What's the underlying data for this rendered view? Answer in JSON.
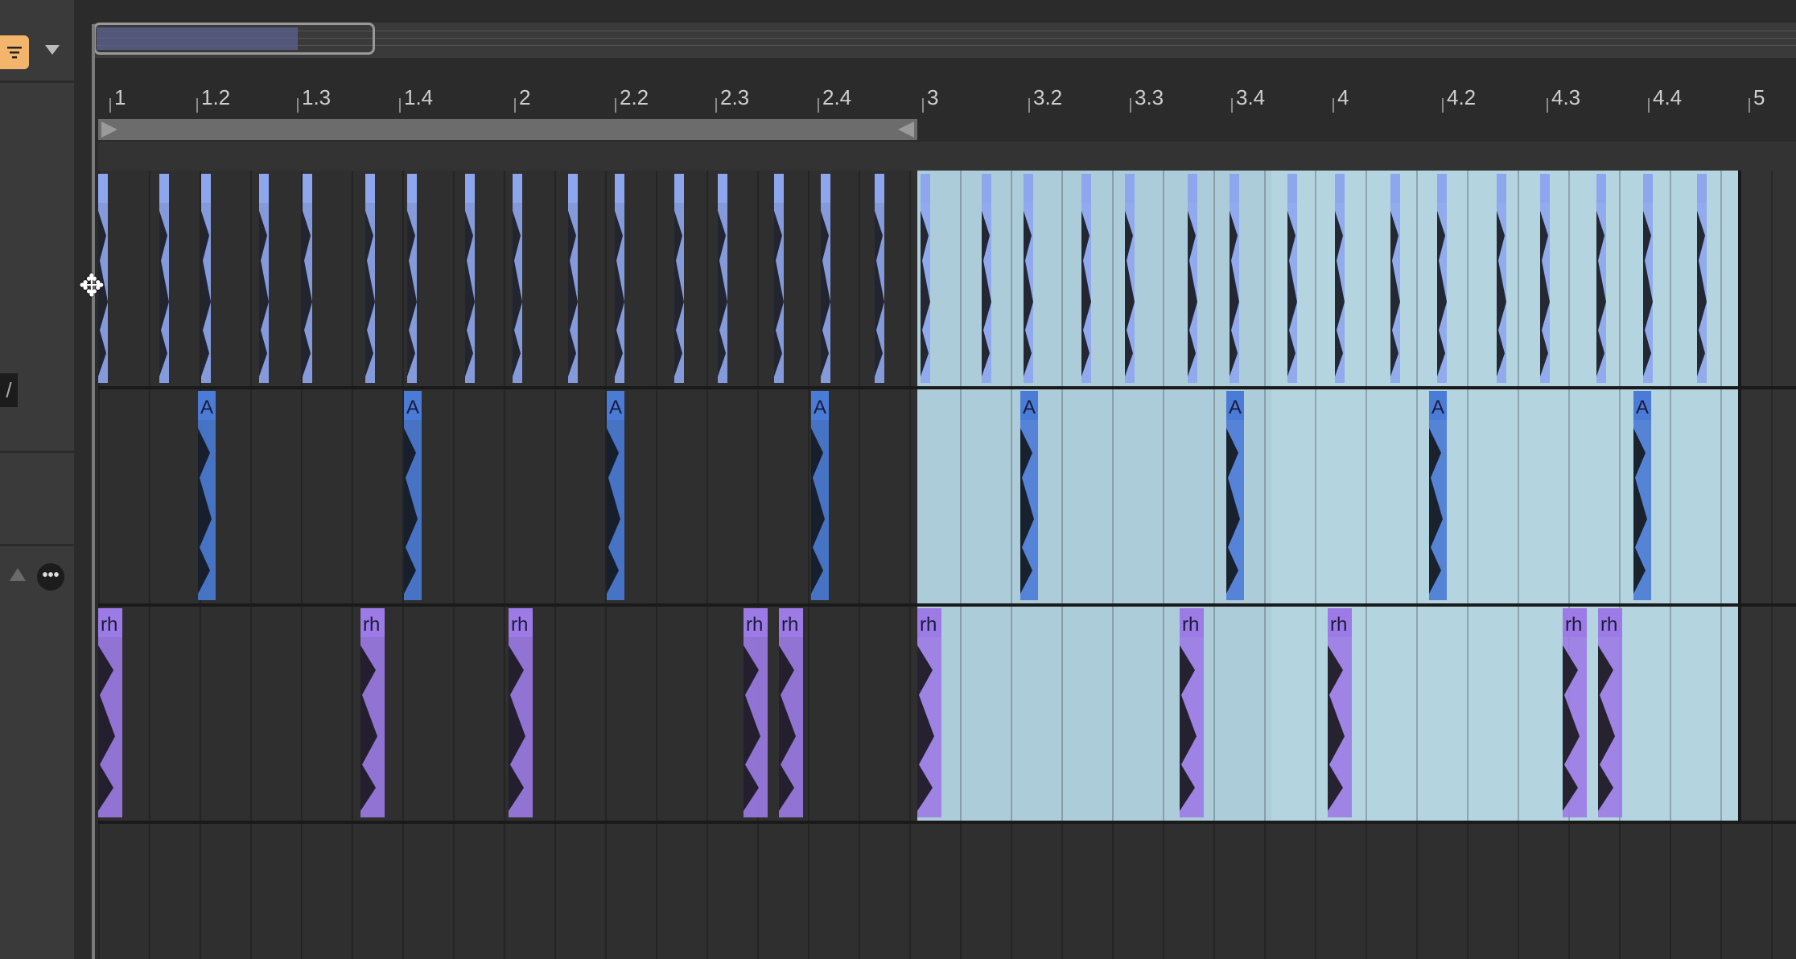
{
  "ruler": {
    "labels": [
      "1",
      "1.2",
      "1.3",
      "1.4",
      "2",
      "2.2",
      "2.3",
      "2.4",
      "3",
      "3.2",
      "3.3",
      "3.4",
      "4",
      "4.2",
      "4.3",
      "4.4",
      "5"
    ]
  },
  "tracks": [
    {
      "name": "hihat-track",
      "clip_label": "",
      "clip_color": "#8ea6ee",
      "clip_count_first_half": 16,
      "clip_count_second_half": 16
    },
    {
      "name": "clap-track",
      "clip_label": "A",
      "clip_color": "#4a7bd6",
      "clip_count_first_half": 4,
      "clip_count_second_half": 4
    },
    {
      "name": "rh-track",
      "clip_label": "rh",
      "clip_color": "#9c7be6",
      "clip_count_first_half": 5,
      "clip_count_second_half": 5
    }
  ],
  "selection": {
    "start_bar": "3",
    "end_bar": "5",
    "color": "#b4d4e0"
  },
  "colors": {
    "accent": "#f2b56b",
    "background": "#2b2b2b",
    "panel": "#3a3a3a"
  },
  "icons": {
    "filter": "filter-icon",
    "dropdown": "chevron-down-icon",
    "more": "more-icon",
    "cursor": "move-cursor-icon"
  }
}
